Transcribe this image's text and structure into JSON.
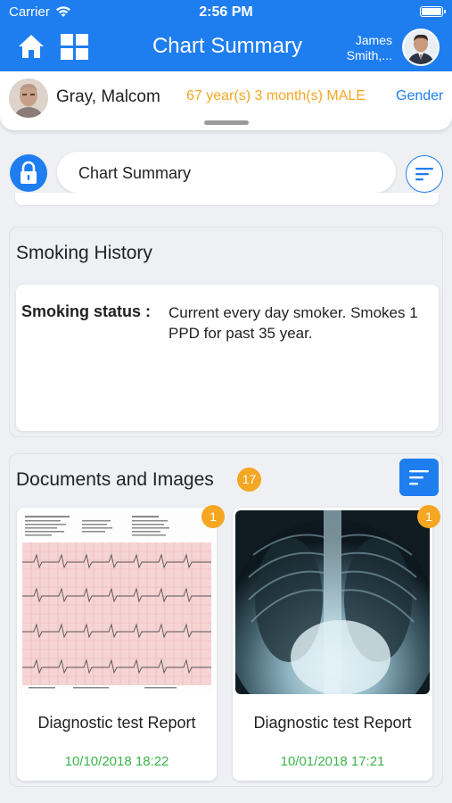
{
  "status_bar": {
    "carrier": "Carrier",
    "time": "2:56 PM"
  },
  "nav": {
    "title": "Chart Summary",
    "user_name_line1": "James",
    "user_name_line2": "Smith,...",
    "home_icon": "home-icon",
    "grid_icon": "grid-icon"
  },
  "patient": {
    "name": "Gray, Malcom",
    "age_sex": "67 year(s) 3 month(s) MALE",
    "gender_label": "Gender"
  },
  "search": {
    "value": "Chart Summary",
    "lock_icon": "lock-icon",
    "filter_icon": "filter-icon"
  },
  "smoking": {
    "title": "Smoking History",
    "label": "Smoking status :",
    "value": "Current every day smoker. Smokes 1 PPD for past 35 year."
  },
  "documents": {
    "title": "Documents and Images",
    "count": "17",
    "items": [
      {
        "name": "Diagnostic test Report",
        "date": "10/10/2018 18:22",
        "badge": "1",
        "thumb": "ecg-report"
      },
      {
        "name": "Diagnostic test Report",
        "date": "10/01/2018 17:21",
        "badge": "1",
        "thumb": "chest-xray"
      }
    ]
  },
  "colors": {
    "primary": "#1e7ef0",
    "accent": "#f5a623",
    "date_green": "#3cb54a"
  }
}
